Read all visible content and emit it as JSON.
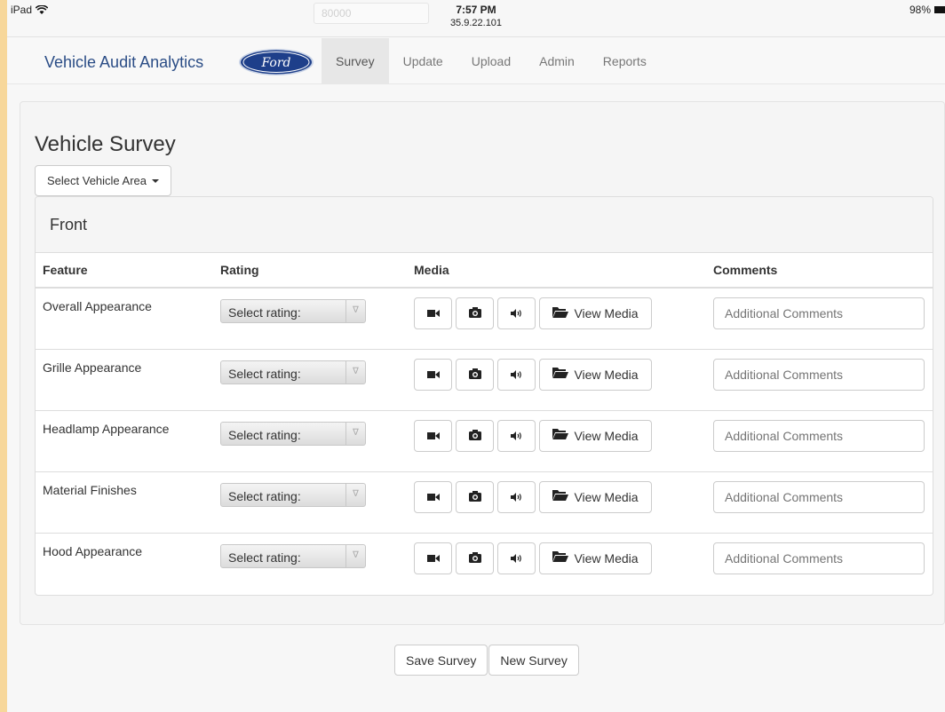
{
  "status_bar": {
    "device": "iPad",
    "url_field": "80000",
    "time": "7:57 PM",
    "ip": "35.9.22.101",
    "battery": "98%"
  },
  "navbar": {
    "brand": "Vehicle Audit Analytics",
    "logo_text": "Ford",
    "items": [
      {
        "label": "Survey",
        "active": true
      },
      {
        "label": "Update",
        "active": false
      },
      {
        "label": "Upload",
        "active": false
      },
      {
        "label": "Admin",
        "active": false
      },
      {
        "label": "Reports",
        "active": false
      }
    ]
  },
  "survey": {
    "title": "Vehicle Survey",
    "area_dropdown": "Select Vehicle Area",
    "section": "Front",
    "columns": [
      "Feature",
      "Rating",
      "Media",
      "Comments"
    ],
    "rating_placeholder": "Select rating:",
    "view_media_label": "View Media",
    "comment_placeholder": "Additional Comments",
    "rows": [
      {
        "feature": "Overall Appearance"
      },
      {
        "feature": "Grille Appearance"
      },
      {
        "feature": "Headlamp Appearance"
      },
      {
        "feature": "Material Finishes"
      },
      {
        "feature": "Hood Appearance"
      }
    ]
  },
  "footer": {
    "save_label": "Save Survey",
    "new_label": "New Survey"
  },
  "colors": {
    "brand": "#2b4d86",
    "accent_border": "#f7d79a"
  }
}
